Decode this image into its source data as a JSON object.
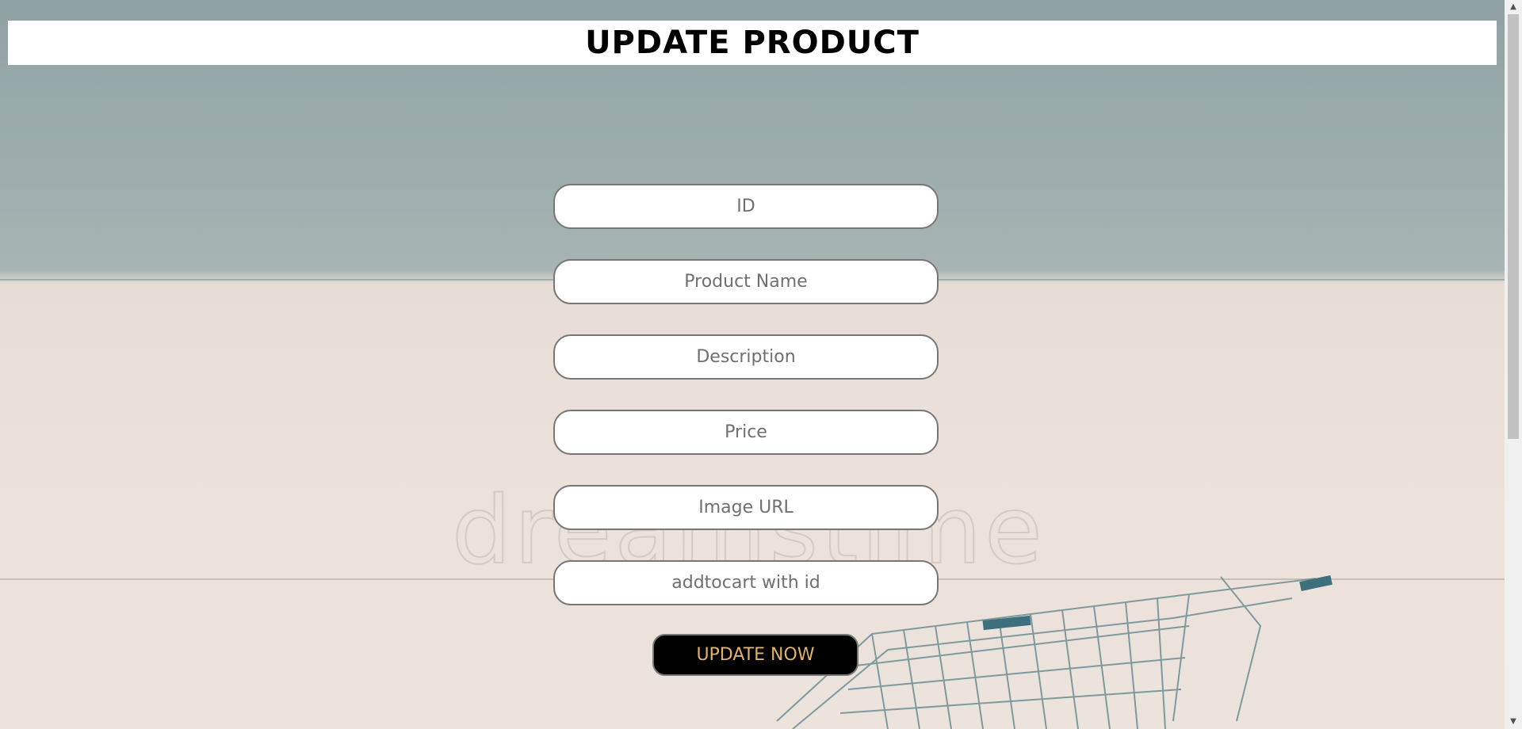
{
  "header": {
    "title": "UPDATE PRODUCT"
  },
  "form": {
    "fields": [
      {
        "name": "id",
        "placeholder": "ID",
        "value": ""
      },
      {
        "name": "product-name",
        "placeholder": "Product Name",
        "value": ""
      },
      {
        "name": "description",
        "placeholder": "Description",
        "value": ""
      },
      {
        "name": "price",
        "placeholder": "Price",
        "value": ""
      },
      {
        "name": "image-url",
        "placeholder": "Image URL",
        "value": ""
      },
      {
        "name": "addtocart",
        "placeholder": "addtocart with id",
        "value": ""
      }
    ],
    "submit_label": "UPDATE NOW"
  },
  "background": {
    "watermark_text": "dreamstime"
  },
  "scrollbar": {
    "up_icon": "triangle-up-icon",
    "down_icon": "triangle-down-icon",
    "up_glyph": "▲",
    "down_glyph": "▼"
  },
  "colors": {
    "button_bg": "#000000",
    "button_text": "#e0b26c",
    "header_bg": "#ffffff"
  }
}
